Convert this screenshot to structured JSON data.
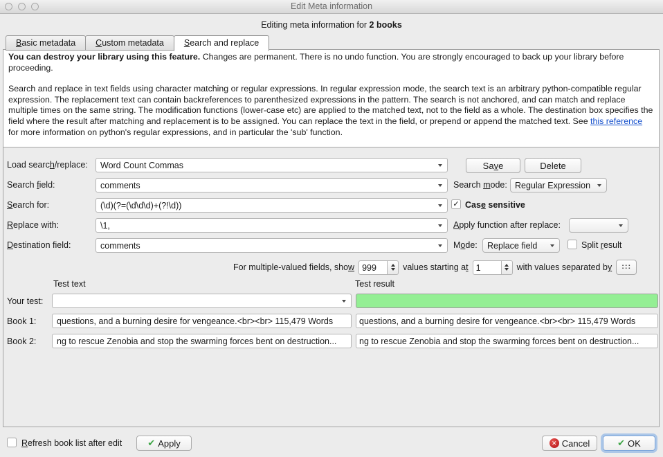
{
  "window": {
    "title": "Edit Meta information"
  },
  "header": {
    "text": "Editing meta information for ",
    "bold": "2 books"
  },
  "tabs": {
    "basic": {
      "accel": "B",
      "post": "asic metadata"
    },
    "custom": {
      "accel": "C",
      "post": "ustom metadata"
    },
    "search": {
      "accel": "S",
      "post": "earch and replace"
    }
  },
  "intro": {
    "warning_bold": "You can destroy your library using this feature.",
    "warning_rest": " Changes are permanent. There is no undo function. You are strongly encouraged to back up your library before proceeding.",
    "body_before_link": "Search and replace in text fields using character matching or regular expressions. In regular expression mode, the search text is an arbitrary python-compatible regular expression. The replacement text can contain backreferences to parenthesized expressions in the pattern. The search is not anchored, and can match and replace multiple times on the same string. The modification functions (lower-case etc) are applied to the matched text, not to the field as a whole. The destination box specifies the field where the result after matching and replacement is to be assigned. You can replace the text in the field, or prepend or append the matched text. See ",
    "link_text": "this reference",
    "body_after_link": " for more information on python's regular expressions, and in particular the 'sub' function."
  },
  "form": {
    "load_label": {
      "pre": "Load searc",
      "accel": "h",
      "post": "/replace:"
    },
    "load_value": "Word Count Commas",
    "save_label": {
      "pre": "Sa",
      "accel": "v",
      "post": "e"
    },
    "delete_label": "Delete",
    "search_field_label": {
      "pre": "Search ",
      "accel": "f",
      "post": "ield:"
    },
    "search_field_value": "comments",
    "search_mode_label": {
      "pre": "Search ",
      "accel": "m",
      "post": "ode:"
    },
    "search_mode_value": "Regular Expression",
    "search_for_label": {
      "pre": "",
      "accel": "S",
      "post": "earch for:"
    },
    "search_for_value": "(\\d)(?=(\\d\\d\\d)+(?!\\d))",
    "case_sensitive_label": {
      "pre": "Cas",
      "accel": "e",
      "post": " sensitive"
    },
    "case_sensitive_checked": true,
    "replace_with_label": {
      "pre": "",
      "accel": "R",
      "post": "eplace with:"
    },
    "replace_with_value": "\\1,",
    "apply_function_label": {
      "pre": "",
      "accel": "A",
      "post": "pply function after replace:"
    },
    "apply_function_value": "",
    "destination_label": {
      "pre": "",
      "accel": "D",
      "post": "estination field:"
    },
    "destination_value": "comments",
    "mode_label": {
      "pre": "M",
      "accel": "o",
      "post": "de:"
    },
    "mode_value": "Replace field",
    "split_result_label": {
      "pre": "Split ",
      "accel": "r",
      "post": "esult"
    },
    "split_result_checked": false,
    "multi": {
      "show_label": {
        "pre": "For multiple-valued fields, sho",
        "accel": "w",
        "post": ""
      },
      "show_value": "999",
      "start_label": {
        "pre": "values starting a",
        "accel": "t",
        "post": ""
      },
      "start_value": "1",
      "sep_label": {
        "pre": "with values separated b",
        "accel": "y",
        "post": ""
      },
      "sep_button": ":::"
    }
  },
  "test": {
    "col1_header": "Test text",
    "col2_header": "Test result",
    "your_test_label": "Your test:",
    "your_test_value": "",
    "your_test_result": "",
    "rows": [
      {
        "label": "Book 1:",
        "text": "questions, and a burning desire for vengeance.<br><br> 115,479 Words",
        "result": "questions, and a burning desire for vengeance.<br><br> 115,479 Words"
      },
      {
        "label": "Book 2:",
        "text": "ng to rescue Zenobia and stop the swarming forces bent on destruction...",
        "result": "ng to rescue Zenobia and stop the swarming forces bent on destruction..."
      }
    ]
  },
  "footer": {
    "refresh_label": {
      "pre": "",
      "accel": "R",
      "post": "efresh book list after edit"
    },
    "refresh_checked": false,
    "apply_label": "Apply",
    "cancel_label": "Cancel",
    "ok_label": "OK"
  },
  "glyphs": {
    "checkbox_check": "✓",
    "button_check": "✔",
    "cancel_cross": "✕"
  },
  "colors": {
    "result_ok_green": "#94ef94",
    "link_blue": "#1550cc",
    "check_green": "#3ea546",
    "cancel_red": "#b41217",
    "ok_focus_ring": "#79a3d9"
  }
}
